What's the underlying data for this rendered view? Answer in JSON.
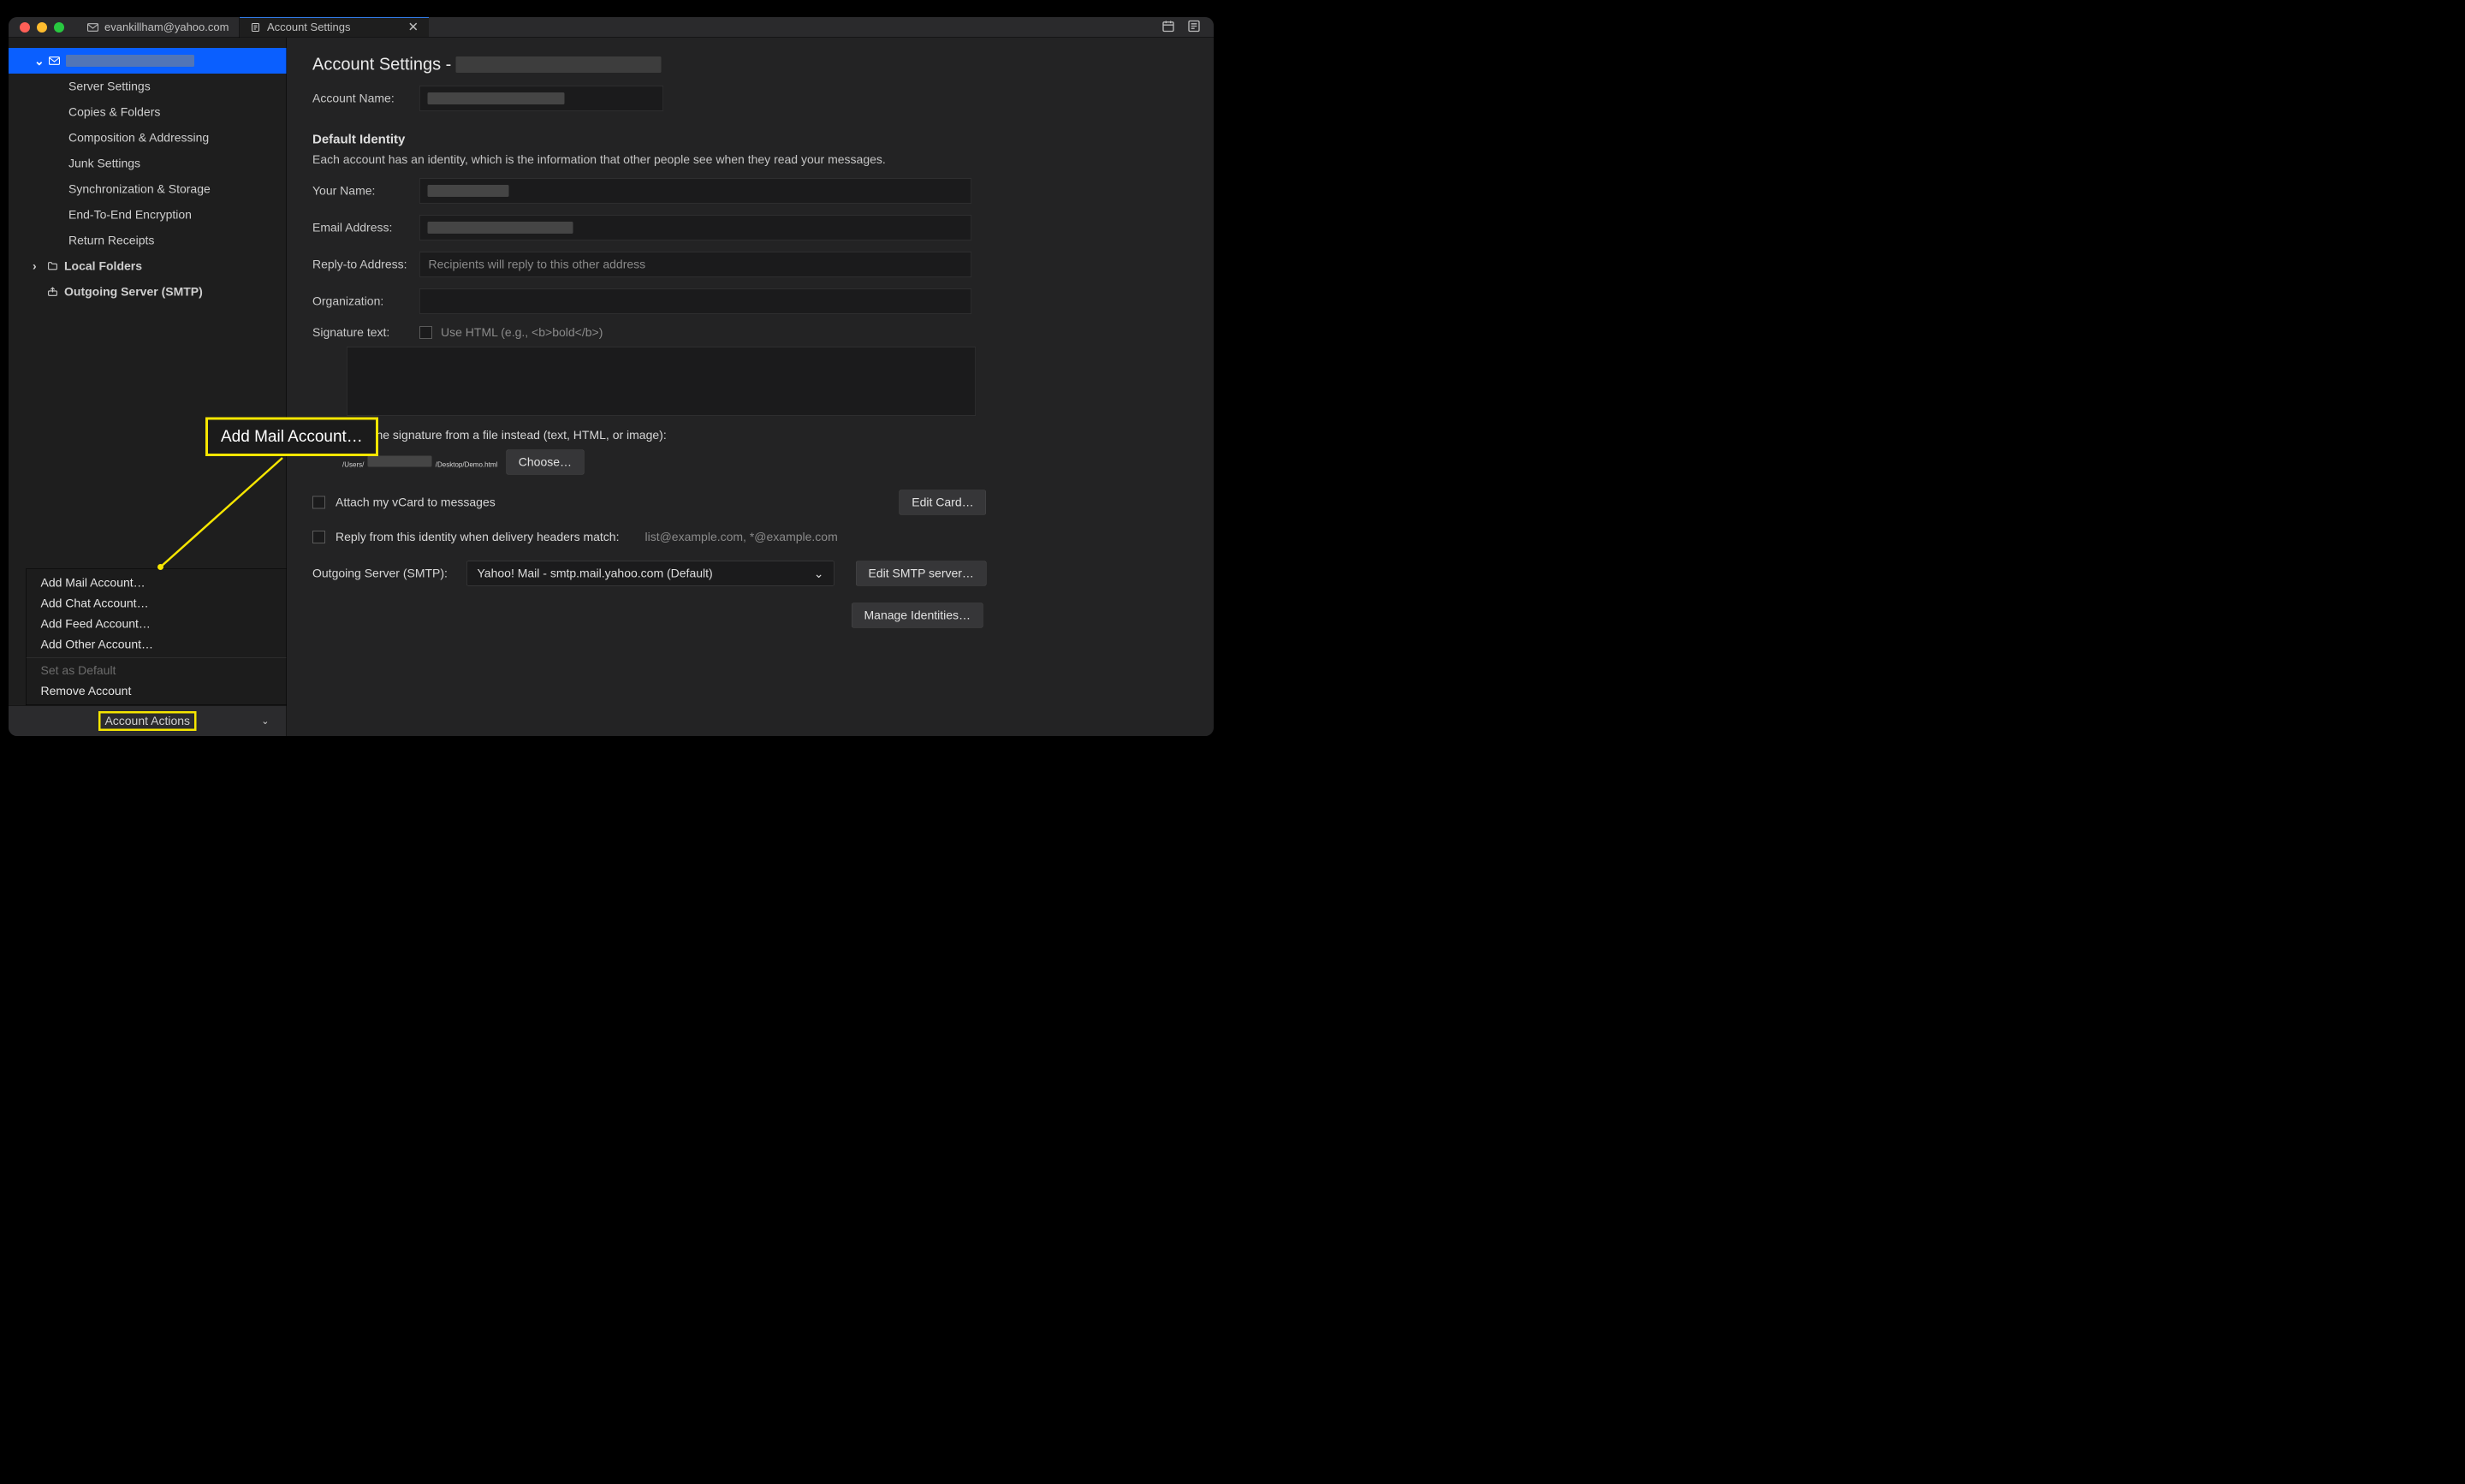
{
  "tabs": {
    "inactive": "evankillham@yahoo.com",
    "active": "Account Settings"
  },
  "sidebar": {
    "items": [
      "Server Settings",
      "Copies & Folders",
      "Composition & Addressing",
      "Junk Settings",
      "Synchronization & Storage",
      "End-To-End Encryption",
      "Return Receipts"
    ],
    "local_folders": "Local Folders",
    "smtp": "Outgoing Server (SMTP)"
  },
  "popup": {
    "items": [
      "Add Mail Account…",
      "Add Chat Account…",
      "Add Feed Account…",
      "Add Other Account…"
    ],
    "disabled": "Set as Default",
    "remove": "Remove Account"
  },
  "account_actions_btn": "Account Actions",
  "callout": "Add Mail Account…",
  "content": {
    "title_prefix": "Account Settings - ",
    "account_name_label": "Account Name:",
    "identity_heading": "Default Identity",
    "identity_desc": "Each account has an identity, which is the information that other people see when they read your messages.",
    "your_name": "Your Name:",
    "email": "Email Address:",
    "reply_to": "Reply-to Address:",
    "reply_to_ph": "Recipients will reply to this other address",
    "org": "Organization:",
    "sig_text": "Signature text:",
    "sig_html_ph": "Use HTML (e.g., <b>bold</b>)",
    "attach_sig": "Attach the signature from a file instead (text, HTML, or image):",
    "sig_path_prefix": "/Users/",
    "sig_path_suffix": "/Desktop/Demo.html",
    "choose": "Choose…",
    "attach_vcard": "Attach my vCard to messages",
    "edit_card": "Edit Card…",
    "reply_identity": "Reply from this identity when delivery headers match:",
    "reply_identity_ph": "list@example.com, *@example.com",
    "smtp_label": "Outgoing Server (SMTP):",
    "smtp_value": "Yahoo! Mail - smtp.mail.yahoo.com (Default)",
    "edit_smtp": "Edit SMTP server…",
    "manage_ids": "Manage Identities…"
  }
}
